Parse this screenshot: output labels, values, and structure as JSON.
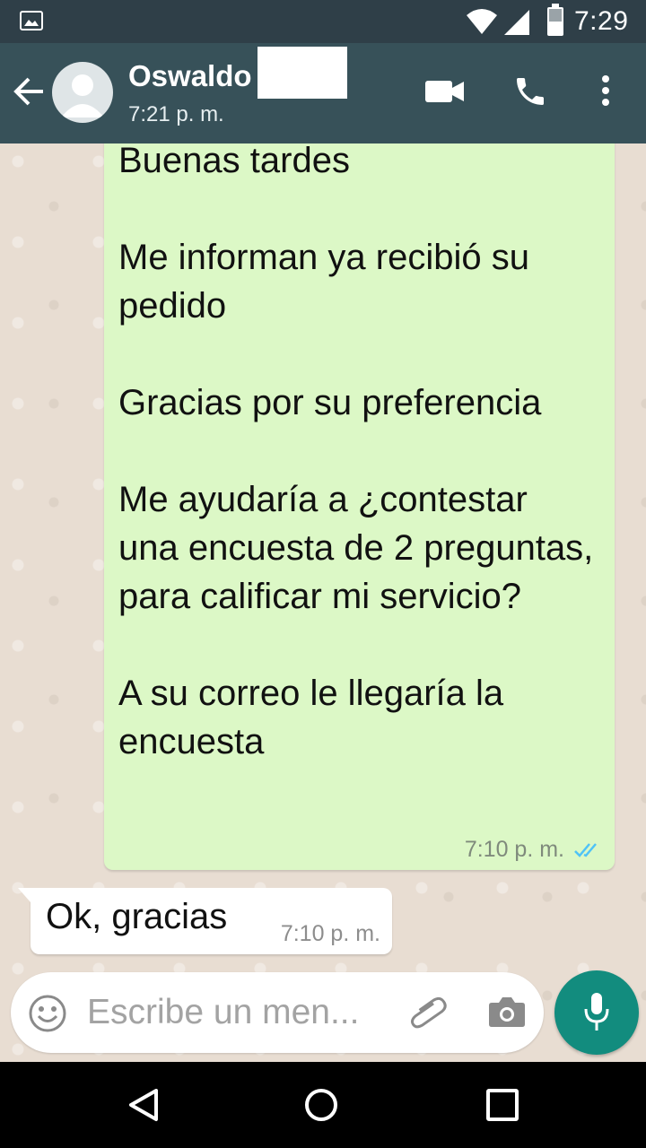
{
  "status_bar": {
    "time": "7:29"
  },
  "header": {
    "contact_name": "Oswaldo",
    "last_seen": "7:21 p. m."
  },
  "messages": [
    {
      "direction": "outgoing",
      "text": "Buenas tardes\n\nMe informan ya recibió su pedido\n\nGracias por su preferencia\n\nMe ayudaría a ¿contestar una encuesta de 2 preguntas, para calificar mi servicio?\n\nA su correo le llegaría la encuesta",
      "time": "7:10 p. m.",
      "status": "read"
    },
    {
      "direction": "incoming",
      "text": "Ok, gracias",
      "time": "7:10 p. m."
    }
  ],
  "composer": {
    "placeholder": "Escribe un men..."
  },
  "colors": {
    "header": "#375159",
    "status_bar": "#2f3f48",
    "outgoing_bubble": "#dcf8c6",
    "incoming_bubble": "#ffffff",
    "accent": "#128c7e",
    "read_ticks": "#4fc3f7"
  },
  "icons": [
    "image-icon",
    "wifi-icon",
    "signal-icon",
    "battery-icon",
    "back-arrow-icon",
    "avatar-icon",
    "video-call-icon",
    "phone-icon",
    "more-icon",
    "double-check-icon",
    "emoji-icon",
    "attach-icon",
    "camera-icon",
    "mic-icon",
    "nav-back-icon",
    "nav-home-icon",
    "nav-recents-icon"
  ]
}
